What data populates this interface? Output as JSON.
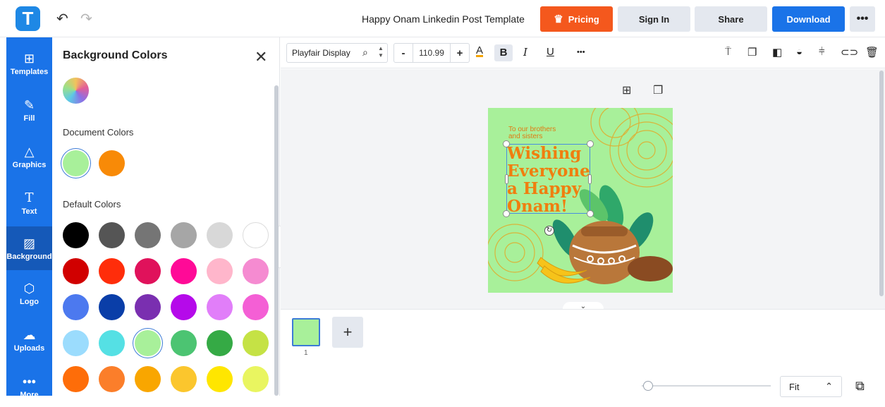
{
  "header": {
    "logo_letter": "T",
    "doc_title": "Happy Onam Linkedin Post Template",
    "pricing_label": "Pricing",
    "signin_label": "Sign In",
    "share_label": "Share",
    "download_label": "Download",
    "more_label": "•••"
  },
  "sidebar": {
    "items": [
      {
        "label": "Templates",
        "icon": "templates-icon"
      },
      {
        "label": "Fill",
        "icon": "pencil-icon"
      },
      {
        "label": "Graphics",
        "icon": "shapes-icon"
      },
      {
        "label": "Text",
        "icon": "text-icon"
      },
      {
        "label": "Background",
        "icon": "background-icon"
      },
      {
        "label": "Logo",
        "icon": "logo-icon"
      },
      {
        "label": "Uploads",
        "icon": "upload-cloud-icon"
      },
      {
        "label": "More",
        "icon": "more-dots-icon"
      }
    ],
    "active": "Background"
  },
  "panel": {
    "title": "Background Colors",
    "document_colors_label": "Document Colors",
    "default_colors_label": "Default Colors",
    "document_colors": [
      "#a8f09a",
      "#f88a07"
    ],
    "selected_color": "#a8f09a",
    "default_colors": [
      [
        "#000000",
        "#555555",
        "#757575",
        "#a6a6a6",
        "#d8d8d8",
        "#ffffff"
      ],
      [
        "#d10000",
        "#ff2d0a",
        "#e0125b",
        "#ff0a97",
        "#ffb6cb",
        "#f58bd1"
      ],
      [
        "#4c79ef",
        "#0a3ea8",
        "#7a2fb0",
        "#b50aea",
        "#e17ef9",
        "#f45fd5"
      ],
      [
        "#9bdcfd",
        "#55e0e4",
        "#a8f09a",
        "#4cc472",
        "#35aa45",
        "#c5e245"
      ],
      [
        "#fe6d09",
        "#fb7e2a",
        "#f9a600",
        "#fbc62d",
        "#ffe600",
        "#e9f560"
      ]
    ]
  },
  "toolbar": {
    "font_name": "Playfair Display",
    "font_size": "110.99",
    "minus": "-",
    "plus": "+",
    "color_letter": "A",
    "bold": "B",
    "italic": "I",
    "underline": "U",
    "more": "•••"
  },
  "canvas": {
    "art": {
      "small_text_line1": "To our brothers",
      "small_text_line2": "and sisters",
      "headline": [
        "Wishing",
        "Everyone",
        "a Happy",
        "Onam!"
      ]
    }
  },
  "pages": {
    "page_number": "1",
    "add_label": "+"
  },
  "zoom": {
    "label": "Fit",
    "level": 0.02
  }
}
